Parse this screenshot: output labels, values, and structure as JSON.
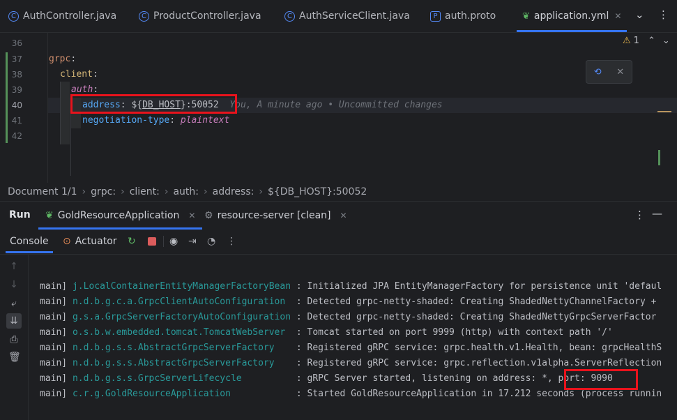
{
  "tabs": [
    {
      "label": "AuthController.java",
      "icon": "java-class-icon"
    },
    {
      "label": "ProductController.java",
      "icon": "java-class-icon"
    },
    {
      "label": "AuthServiceClient.java",
      "icon": "java-class-icon"
    },
    {
      "label": "auth.proto",
      "icon": "proto-file-icon"
    },
    {
      "label": "application.yml",
      "icon": "spring-leaf-icon",
      "active": true
    }
  ],
  "editor": {
    "line_numbers": [
      "36",
      "37",
      "38",
      "39",
      "40",
      "41",
      "42"
    ],
    "lines": {
      "grpc": "grpc",
      "client": "client",
      "auth": "auth",
      "address_key": "address",
      "address_value_prefix": "${",
      "address_value_var": "DB_HOST",
      "address_value_suffix": "}:50052",
      "negotiation_key": "negotiation-type",
      "negotiation_value": "plaintext"
    },
    "blame": "You, A minute ago • Uncommitted changes",
    "warning_count": "1"
  },
  "breadcrumb": [
    "Document 1/1",
    "grpc:",
    "client:",
    "auth:",
    "address:",
    "${DB_HOST}:50052"
  ],
  "run": {
    "label": "Run",
    "tabs": [
      {
        "label": "GoldResourceApplication",
        "active": true
      },
      {
        "label": "resource-server [clean]"
      }
    ]
  },
  "console": {
    "tabs": [
      "Console",
      "Actuator"
    ],
    "logs": [
      {
        "thread": "main]",
        "logger": "j.LocalContainerEntityManagerFactoryBean",
        "message": ": Initialized JPA EntityManagerFactory for persistence unit 'defaul"
      },
      {
        "thread": "main]",
        "logger": "n.d.b.g.c.a.GrpcClientAutoConfiguration ",
        "message": ": Detected grpc-netty-shaded: Creating ShadedNettyChannelFactory +"
      },
      {
        "thread": "main]",
        "logger": "g.s.a.GrpcServerFactoryAutoConfiguration",
        "message": ": Detected grpc-netty-shaded: Creating ShadedNettyGrpcServerFactor"
      },
      {
        "thread": "main]",
        "logger": "o.s.b.w.embedded.tomcat.TomcatWebServer ",
        "message": ": Tomcat started on port 9999 (http) with context path '/'"
      },
      {
        "thread": "main]",
        "logger": "n.d.b.g.s.s.AbstractGrpcServerFactory   ",
        "message": ": Registered gRPC service: grpc.health.v1.Health, bean: grpcHealthS"
      },
      {
        "thread": "main]",
        "logger": "n.d.b.g.s.s.AbstractGrpcServerFactory   ",
        "message": ": Registered gRPC service: grpc.reflection.v1alpha.ServerReflection"
      },
      {
        "thread": "main]",
        "logger": "n.d.b.g.s.s.GrpcServerLifecycle         ",
        "message": ": gRPC Server started, listening on address: *, port: 9090"
      },
      {
        "thread": "main]",
        "logger": "c.r.g.GoldResourceApplication           ",
        "message": ": Started GoldResourceApplication in 17.212 seconds (process runnin"
      }
    ]
  },
  "colors": {
    "accent": "#3574f0",
    "highlight_box": "#e8131c",
    "logger": "#299999"
  }
}
